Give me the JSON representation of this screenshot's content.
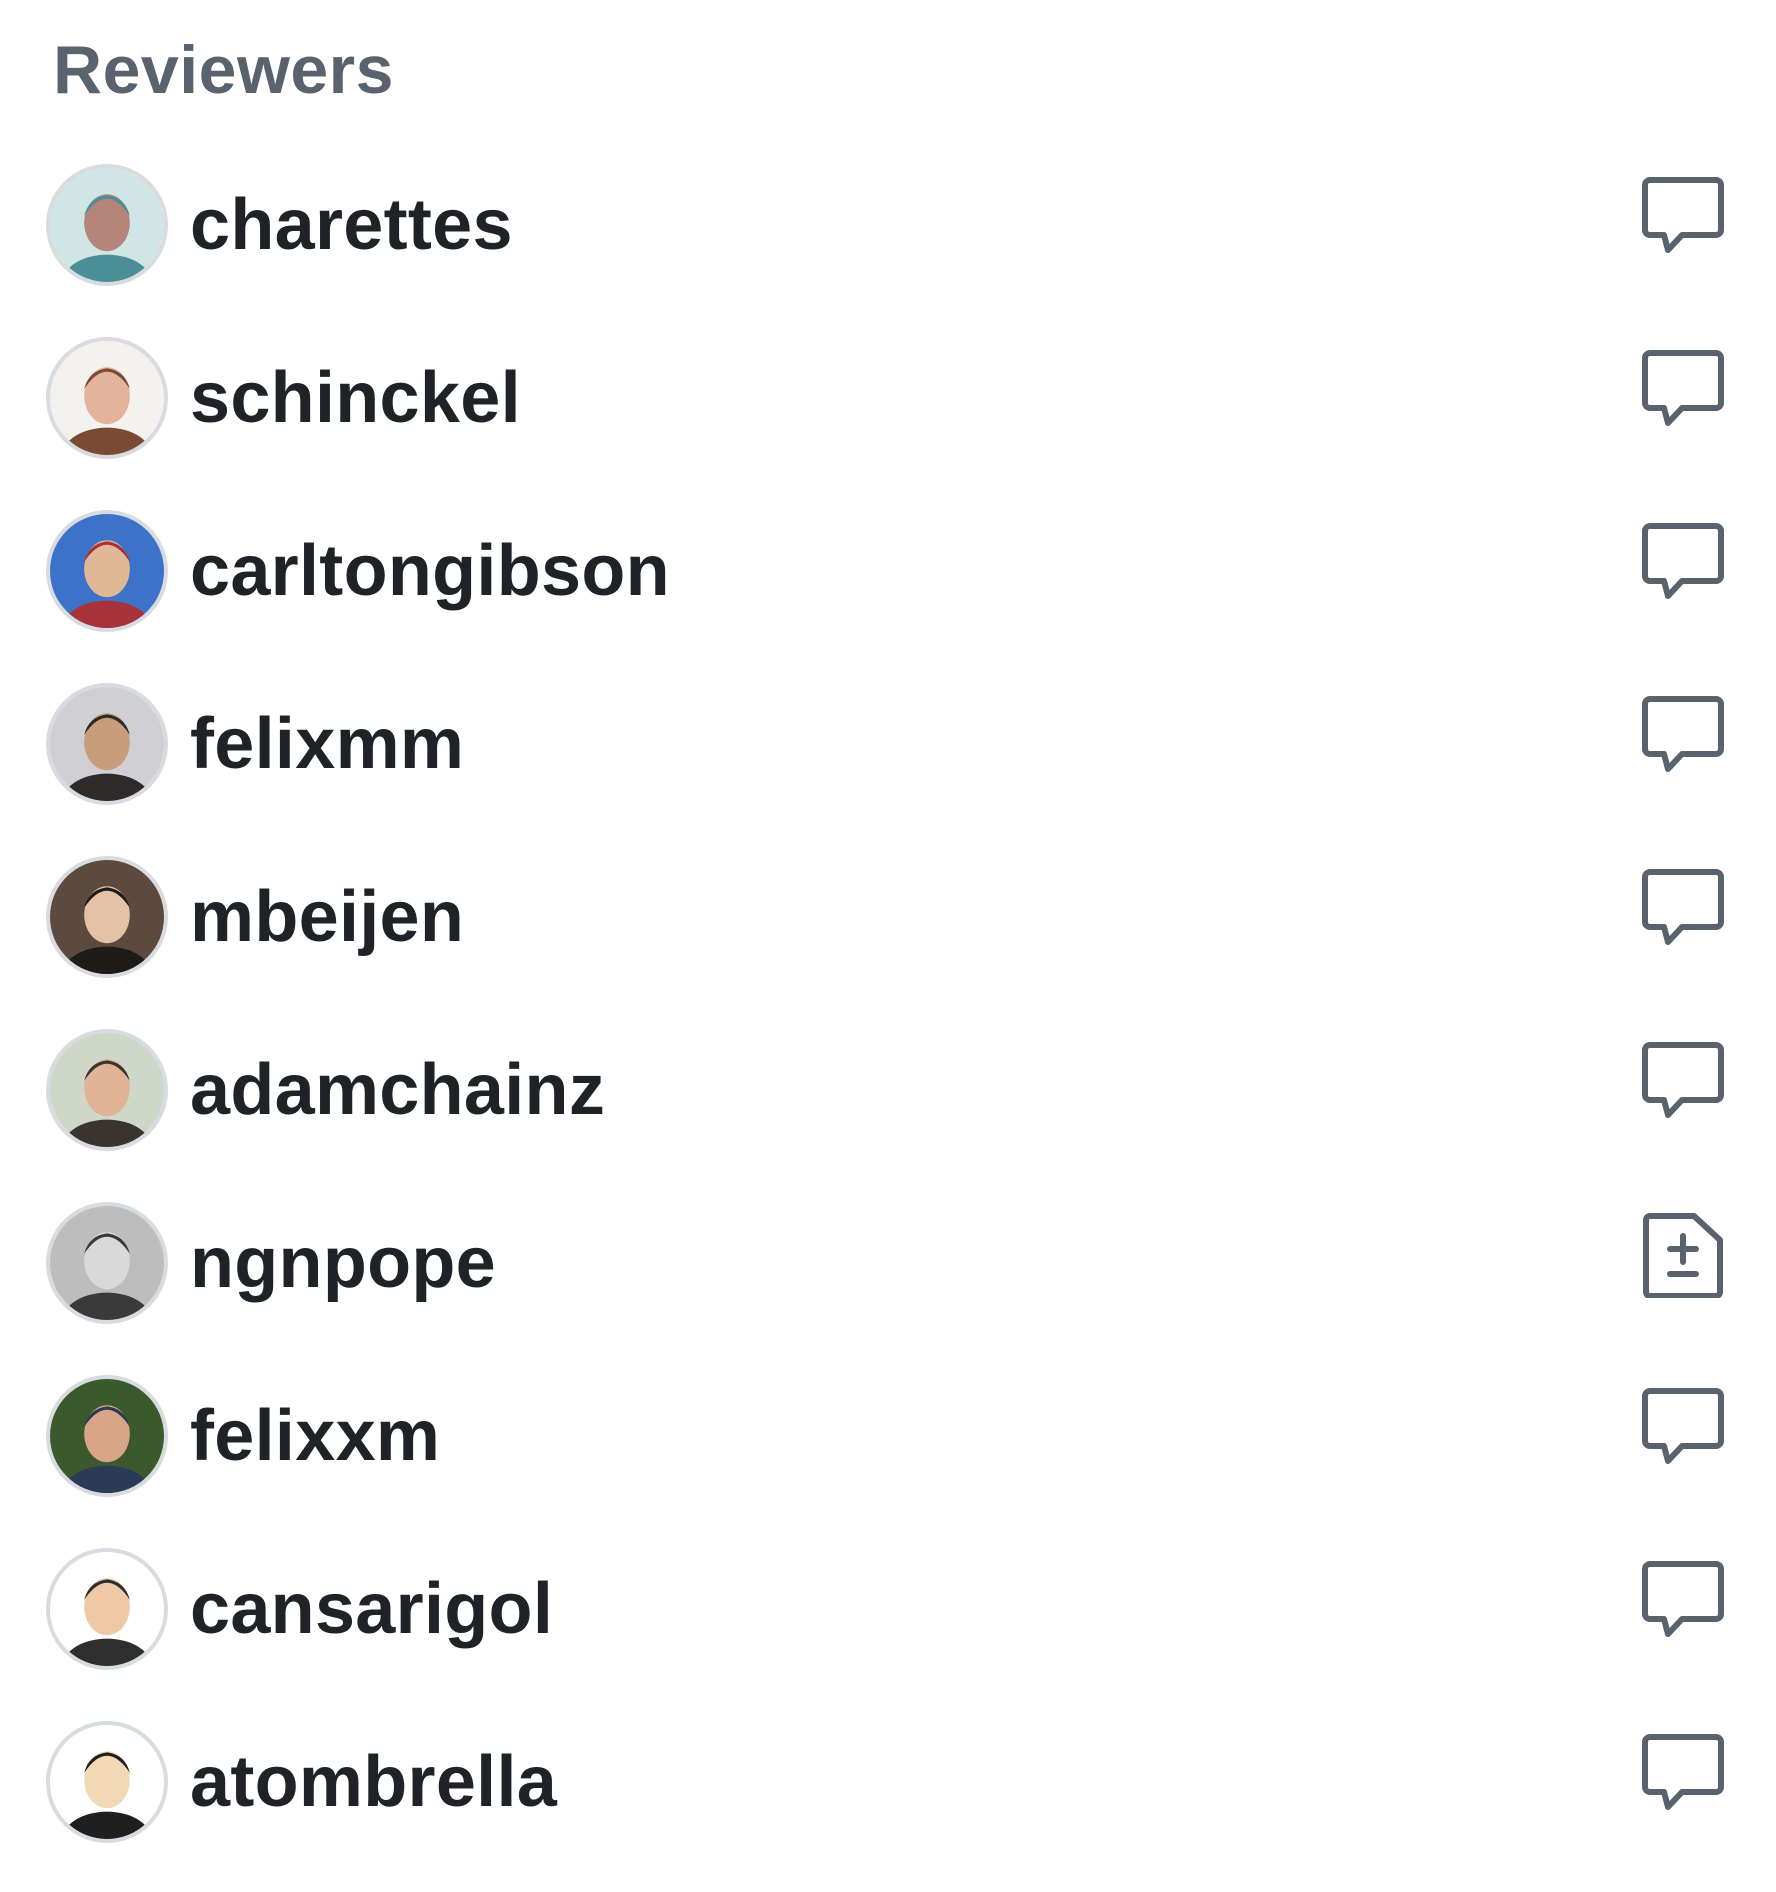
{
  "sidebar": {
    "heading": "Reviewers",
    "reviewers": [
      {
        "username": "charettes",
        "status_icon": "comment-icon",
        "avatar_colors": [
          "#cfe6e4",
          "#4a8f95",
          "#b5857a"
        ]
      },
      {
        "username": "schinckel",
        "status_icon": "comment-icon",
        "avatar_colors": [
          "#f4f2ef",
          "#7a4a35",
          "#e3b49b"
        ]
      },
      {
        "username": "carltongibson",
        "status_icon": "comment-icon",
        "avatar_colors": [
          "#3d72c9",
          "#a7323a",
          "#e0b896"
        ]
      },
      {
        "username": "felixmm",
        "status_icon": "comment-icon",
        "avatar_colors": [
          "#cfcfd4",
          "#2e2a2a",
          "#c79d7c"
        ]
      },
      {
        "username": "mbeijen",
        "status_icon": "comment-icon",
        "avatar_colors": [
          "#5b4a3d",
          "#1f1b19",
          "#e5c2a5"
        ]
      },
      {
        "username": "adamchainz",
        "status_icon": "comment-icon",
        "avatar_colors": [
          "#cfd8c8",
          "#3a3430",
          "#e1b497"
        ]
      },
      {
        "username": "ngnpope",
        "status_icon": "file-diff-icon",
        "avatar_colors": [
          "#bdbdbd",
          "#3a3a3a",
          "#d9d9d9"
        ]
      },
      {
        "username": "felixxm",
        "status_icon": "comment-icon",
        "avatar_colors": [
          "#3a5a2e",
          "#2b3a55",
          "#d8a586"
        ]
      },
      {
        "username": "cansarigol",
        "status_icon": "comment-icon",
        "avatar_colors": [
          "#ffffff",
          "#2e2e2e",
          "#efc9a6"
        ]
      },
      {
        "username": "atombrella",
        "status_icon": "comment-icon",
        "avatar_colors": [
          "#ffffff",
          "#1f1f1f",
          "#f2d9b6"
        ]
      }
    ]
  },
  "colors": {
    "heading": "#59636e",
    "username": "#1f2328",
    "icon_stroke": "#59636e",
    "avatar_border": "#d8dce0"
  }
}
